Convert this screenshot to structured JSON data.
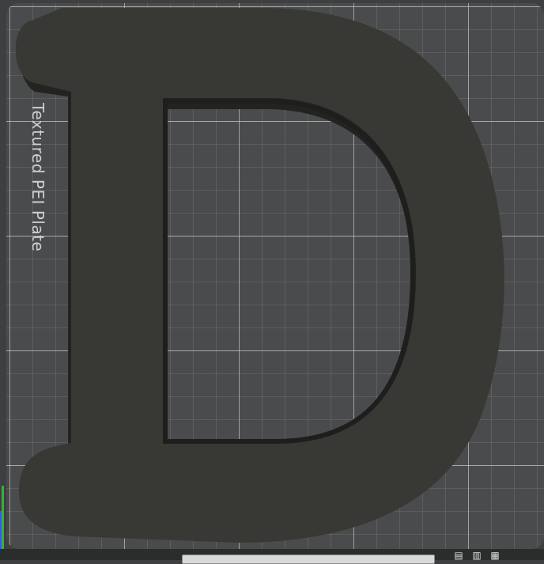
{
  "viewport": {
    "plate_name": "Textured PEI Plate",
    "model_letter": "D"
  },
  "colors": {
    "background": "#3e3f40",
    "plate": "#4a4b4c",
    "grid_line": "#c8c8c8",
    "model_face": "#383835",
    "model_shadow": "#232321",
    "axis_x": "#d62020",
    "axis_y": "#2fb53a",
    "axis_z": "#3b5bd8"
  },
  "icons": [
    "arrange-icon",
    "orient-icon",
    "layout-icon"
  ]
}
